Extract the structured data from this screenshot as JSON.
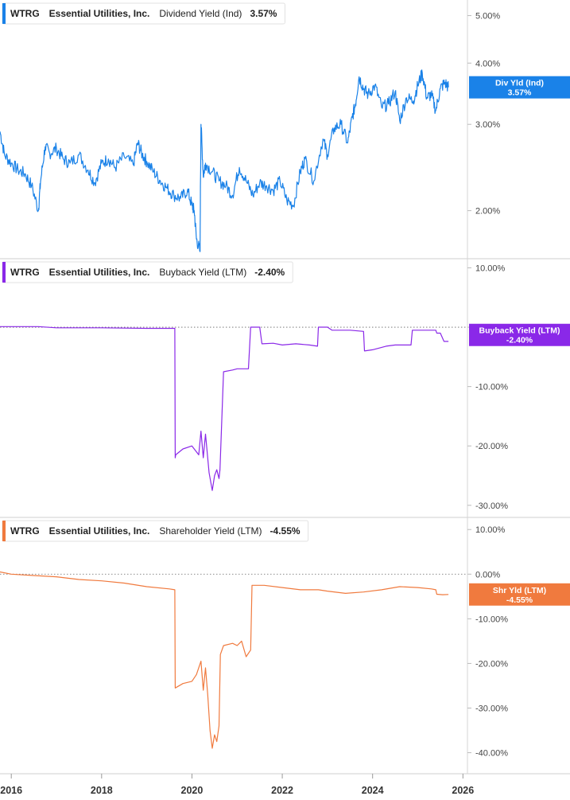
{
  "chart_data": {
    "type": "line",
    "x_axis": {
      "ticks": [
        "2016",
        "2018",
        "2020",
        "2022",
        "2024",
        "2026"
      ],
      "range": [
        2015.75,
        2026.1
      ]
    },
    "panels": [
      {
        "ticker": "WTRG",
        "company": "Essential Utilities, Inc.",
        "metric": "Dividend Yield (Ind)",
        "value_label": "3.57%",
        "color": "#1a82e8",
        "scale": "log",
        "ylim": [
          1.62,
          5.3
        ],
        "yticks": [
          {
            "v": 5,
            "label": "5.00%"
          },
          {
            "v": 4,
            "label": "4.00%"
          },
          {
            "v": 3,
            "label": "3.00%"
          },
          {
            "v": 2,
            "label": "2.00%"
          }
        ],
        "zero_line": false,
        "tag": {
          "title": "Div Yld (Ind)",
          "value": "3.57%",
          "y": 3.57
        },
        "series": {
          "name": "Dividend Yield (Ind)",
          "x": [
            2015.75,
            2015.85,
            2016.0,
            2016.15,
            2016.3,
            2016.45,
            2016.6,
            2016.65,
            2016.75,
            2016.85,
            2017.0,
            2017.15,
            2017.3,
            2017.5,
            2017.7,
            2017.85,
            2018.0,
            2018.15,
            2018.3,
            2018.5,
            2018.7,
            2018.8,
            2018.9,
            2019.0,
            2019.15,
            2019.3,
            2019.45,
            2019.6,
            2019.75,
            2019.9,
            2020.0,
            2020.05,
            2020.1,
            2020.18,
            2020.2,
            2020.25,
            2020.3,
            2020.45,
            2020.6,
            2020.75,
            2020.9,
            2021.05,
            2021.2,
            2021.35,
            2021.5,
            2021.65,
            2021.8,
            2021.95,
            2022.1,
            2022.25,
            2022.4,
            2022.5,
            2022.7,
            2022.9,
            2023.0,
            2023.15,
            2023.3,
            2023.45,
            2023.55,
            2023.62,
            2023.7,
            2023.8,
            2023.9,
            2024.05,
            2024.2,
            2024.35,
            2024.5,
            2024.6,
            2024.75,
            2024.9,
            2025.0,
            2025.1,
            2025.2,
            2025.3,
            2025.4,
            2025.5,
            2025.6,
            2025.68
          ],
          "y": [
            2.9,
            2.6,
            2.5,
            2.42,
            2.38,
            2.25,
            2.0,
            2.3,
            2.7,
            2.62,
            2.68,
            2.55,
            2.5,
            2.6,
            2.42,
            2.28,
            2.5,
            2.55,
            2.45,
            2.58,
            2.48,
            2.75,
            2.6,
            2.52,
            2.4,
            2.3,
            2.22,
            2.15,
            2.12,
            2.2,
            2.05,
            2.0,
            1.75,
            1.65,
            3.0,
            2.35,
            2.5,
            2.4,
            2.3,
            2.25,
            2.15,
            2.45,
            2.3,
            2.15,
            2.28,
            2.25,
            2.2,
            2.3,
            2.1,
            2.05,
            2.4,
            2.55,
            2.3,
            2.8,
            2.6,
            2.95,
            3.0,
            2.75,
            3.1,
            3.3,
            3.75,
            3.55,
            3.45,
            3.6,
            3.25,
            3.3,
            3.5,
            3.05,
            3.4,
            3.35,
            3.6,
            3.82,
            3.4,
            3.45,
            3.2,
            3.55,
            3.65,
            3.57
          ]
        }
      },
      {
        "ticker": "WTRG",
        "company": "Essential Utilities, Inc.",
        "metric": "Buyback Yield (LTM)",
        "value_label": "-2.40%",
        "color": "#8a28e8",
        "scale": "linear",
        "ylim": [
          -31.5,
          11
        ],
        "yticks": [
          {
            "v": 10,
            "label": "10.00%"
          },
          {
            "v": 0,
            "label": "0.00%"
          },
          {
            "v": -10,
            "label": "-10.00%"
          },
          {
            "v": -20,
            "label": "-20.00%"
          },
          {
            "v": -30,
            "label": "-30.00%"
          }
        ],
        "zero_line": true,
        "tag": {
          "title": "Buyback Yield (LTM)",
          "value": "-2.40%",
          "y": -1.3
        },
        "series": {
          "name": "Buyback Yield (LTM)",
          "x": [
            2015.75,
            2016.6,
            2017.0,
            2018.0,
            2019.0,
            2019.62,
            2019.63,
            2019.64,
            2019.8,
            2020.0,
            2020.15,
            2020.2,
            2020.25,
            2020.3,
            2020.38,
            2020.45,
            2020.5,
            2020.55,
            2020.6,
            2020.62,
            2020.7,
            2020.9,
            2021.0,
            2021.25,
            2021.3,
            2021.5,
            2021.55,
            2021.56,
            2021.8,
            2022.0,
            2022.3,
            2022.6,
            2022.78,
            2022.8,
            2023.0,
            2023.1,
            2023.5,
            2023.8,
            2023.82,
            2024.0,
            2024.3,
            2024.5,
            2024.85,
            2024.88,
            2025.2,
            2025.4,
            2025.42,
            2025.5,
            2025.58,
            2025.68
          ],
          "y": [
            0.1,
            0.1,
            -0.1,
            -0.1,
            -0.2,
            -0.2,
            -22.0,
            -21.5,
            -20.5,
            -20.0,
            -21.5,
            -17.5,
            -22.0,
            -18.0,
            -24.5,
            -27.5,
            -25.0,
            -24.0,
            -25.5,
            -24.0,
            -7.5,
            -7.2,
            -7.0,
            -7.0,
            0.0,
            0.0,
            -2.8,
            -2.8,
            -2.7,
            -3.0,
            -2.8,
            -3.0,
            -3.2,
            0.0,
            0.0,
            -0.5,
            -0.5,
            -0.7,
            -4.0,
            -3.8,
            -3.2,
            -3.0,
            -3.0,
            -0.5,
            -0.5,
            -0.5,
            -1.0,
            -1.0,
            -2.4,
            -2.4
          ]
        }
      },
      {
        "ticker": "WTRG",
        "company": "Essential Utilities, Inc.",
        "metric": "Shareholder Yield (LTM)",
        "value_label": "-4.55%",
        "color": "#f07a3e",
        "scale": "linear",
        "ylim": [
          -44,
          12
        ],
        "yticks": [
          {
            "v": 10,
            "label": "10.00%"
          },
          {
            "v": 0,
            "label": "0.00%"
          },
          {
            "v": -10,
            "label": "-10.00%"
          },
          {
            "v": -20,
            "label": "-20.00%"
          },
          {
            "v": -30,
            "label": "-30.00%"
          },
          {
            "v": -40,
            "label": "-40.00%"
          }
        ],
        "zero_line": true,
        "tag": {
          "title": "Shr Yld (LTM)",
          "value": "-4.55%",
          "y": -4.55
        },
        "series": {
          "name": "Shareholder Yield (LTM)",
          "x": [
            2015.75,
            2016.0,
            2016.5,
            2017.0,
            2017.5,
            2018.0,
            2018.5,
            2019.0,
            2019.5,
            2019.62,
            2019.63,
            2019.8,
            2020.0,
            2020.1,
            2020.2,
            2020.25,
            2020.3,
            2020.35,
            2020.4,
            2020.45,
            2020.5,
            2020.55,
            2020.6,
            2020.63,
            2020.7,
            2020.9,
            2021.0,
            2021.1,
            2021.2,
            2021.3,
            2021.33,
            2021.6,
            2022.0,
            2022.4,
            2022.8,
            2023.0,
            2023.4,
            2023.8,
            2024.2,
            2024.6,
            2025.0,
            2025.3,
            2025.4,
            2025.42,
            2025.55,
            2025.68
          ],
          "y": [
            0.5,
            0.0,
            -0.3,
            -0.6,
            -1.2,
            -1.5,
            -2.0,
            -2.8,
            -3.3,
            -3.5,
            -25.5,
            -24.5,
            -24.0,
            -22.5,
            -19.5,
            -26.0,
            -21.0,
            -27.0,
            -35.0,
            -39.0,
            -36.0,
            -37.5,
            -34.0,
            -18.0,
            -16.0,
            -15.5,
            -16.0,
            -15.0,
            -18.5,
            -17.0,
            -2.5,
            -2.5,
            -3.0,
            -3.5,
            -3.5,
            -3.8,
            -4.3,
            -4.0,
            -3.5,
            -2.8,
            -3.0,
            -3.3,
            -3.5,
            -4.5,
            -4.6,
            -4.55
          ]
        }
      }
    ]
  }
}
